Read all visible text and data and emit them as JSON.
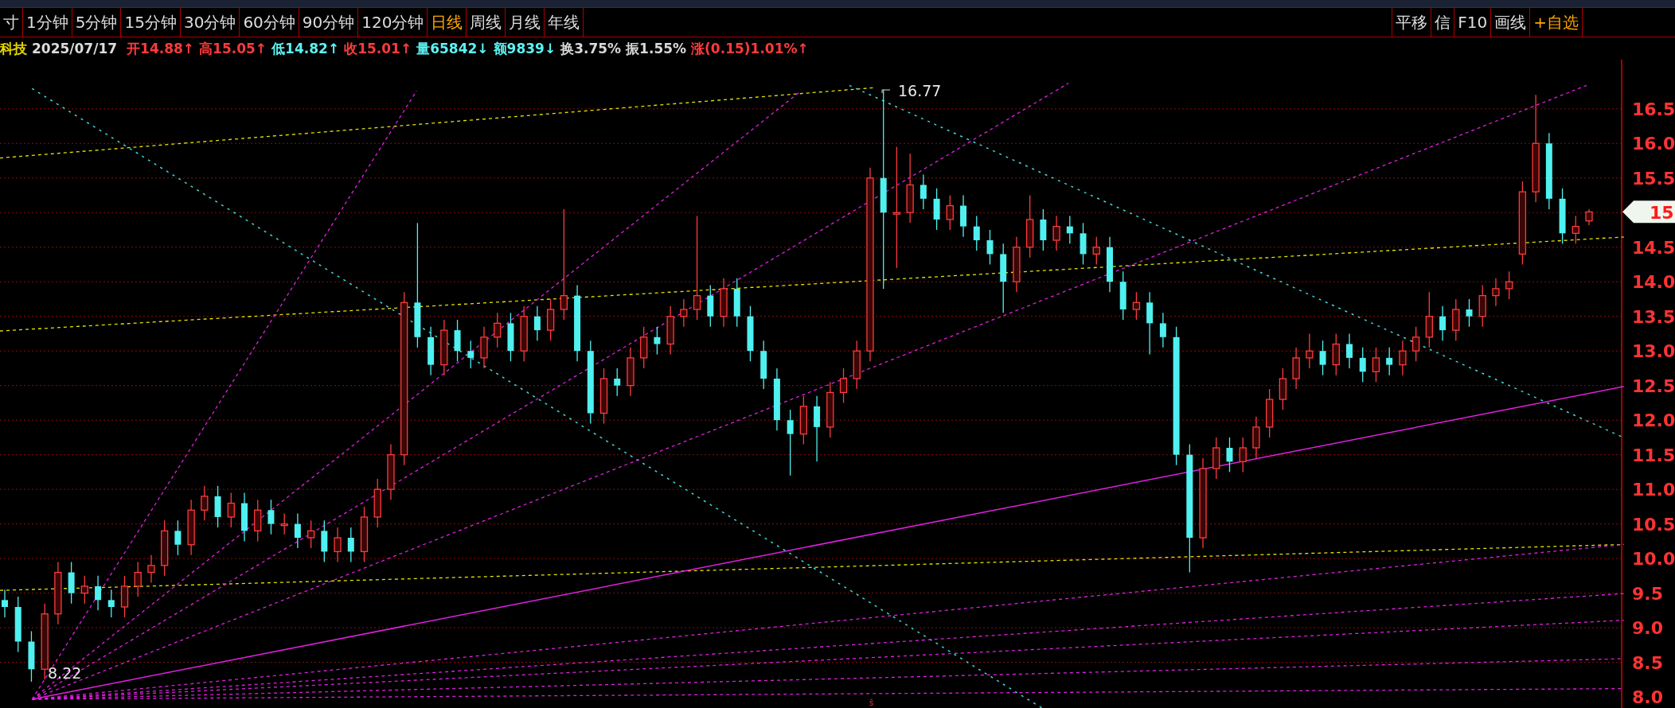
{
  "tabs": [
    {
      "label": "寸",
      "selected": false
    },
    {
      "label": "1分钟",
      "selected": false
    },
    {
      "label": "5分钟",
      "selected": false
    },
    {
      "label": "15分钟",
      "selected": false
    },
    {
      "label": "30分钟",
      "selected": false
    },
    {
      "label": "60分钟",
      "selected": false
    },
    {
      "label": "90分钟",
      "selected": false
    },
    {
      "label": "120分钟",
      "selected": false
    },
    {
      "label": "日线",
      "selected": true
    },
    {
      "label": "周线",
      "selected": false
    },
    {
      "label": "月线",
      "selected": false
    },
    {
      "label": "年线",
      "selected": false
    }
  ],
  "toolbar": [
    {
      "label": "平移",
      "kind": "plain"
    },
    {
      "label": "信",
      "kind": "plain"
    },
    {
      "label": "F10",
      "kind": "plain"
    },
    {
      "label": "画线",
      "kind": "plain"
    },
    {
      "label": "+自选",
      "kind": "add"
    }
  ],
  "info": {
    "name": "科技",
    "date": "2025/07/17",
    "fields": [
      {
        "label": "开",
        "value": "14.88",
        "arrow": "↑",
        "color": "#ff3b3b"
      },
      {
        "label": "高",
        "value": "15.05",
        "arrow": "↑",
        "color": "#ff3b3b"
      },
      {
        "label": "低",
        "value": "14.82",
        "arrow": "↑",
        "color": "#5cf2f2"
      },
      {
        "label": "收",
        "value": "15.01",
        "arrow": "↑",
        "color": "#ff3b3b"
      },
      {
        "label": "量",
        "value": "65842",
        "arrow": "↓",
        "color": "#5cf2f2"
      },
      {
        "label": "额",
        "value": "9839",
        "arrow": "↓",
        "color": "#5cf2f2"
      },
      {
        "label": "换",
        "value": "3.75%",
        "color": "#d8d8d8"
      },
      {
        "label": "振",
        "value": "1.55%",
        "color": "#d8d8d8"
      },
      {
        "label": "涨",
        "value": "(0.15)1.01%",
        "arrow": "↑",
        "color": "#ff3b3b"
      }
    ]
  },
  "chart": {
    "price_tag": "15.",
    "high_marker": "16.77",
    "low_marker": "8.22",
    "bottom_marker": "ŝ",
    "chart_data": {
      "type": "candlestick",
      "categories": [
        null,
        null,
        null,
        null,
        null,
        null,
        null,
        null,
        null,
        null,
        null,
        null,
        null,
        null,
        null,
        null,
        null,
        null,
        null,
        null,
        null,
        null,
        null,
        null,
        null,
        null,
        null,
        null,
        null,
        null,
        null,
        null,
        null,
        null,
        null,
        null,
        null,
        null,
        null,
        null,
        null,
        null,
        null,
        null,
        null,
        null,
        null,
        null,
        null,
        null,
        null,
        null,
        null,
        null,
        null,
        null,
        null,
        null,
        null,
        null,
        null,
        null,
        null,
        null,
        null,
        null,
        null,
        null,
        null,
        null,
        null,
        null,
        null,
        null,
        null,
        null,
        null,
        null,
        null,
        null,
        null,
        null,
        null,
        null,
        null,
        null,
        null,
        null,
        null,
        null,
        null,
        null,
        null,
        null,
        null,
        null,
        null,
        null,
        null,
        null,
        null,
        null,
        null,
        null,
        null,
        null,
        null,
        null,
        null,
        null,
        null,
        null,
        null,
        null,
        null,
        null,
        null,
        null,
        null,
        null
      ],
      "ohlc": [
        [
          9.4,
          9.55,
          9.15,
          9.3
        ],
        [
          9.3,
          9.45,
          8.65,
          8.8
        ],
        [
          8.8,
          8.95,
          8.22,
          8.4
        ],
        [
          8.4,
          9.35,
          8.25,
          9.2
        ],
        [
          9.2,
          9.95,
          9.05,
          9.8
        ],
        [
          9.8,
          9.95,
          9.35,
          9.5
        ],
        [
          9.5,
          9.75,
          9.35,
          9.6
        ],
        [
          9.6,
          9.75,
          9.25,
          9.4
        ],
        [
          9.4,
          9.55,
          9.15,
          9.3
        ],
        [
          9.3,
          9.75,
          9.15,
          9.6
        ],
        [
          9.6,
          9.95,
          9.45,
          9.8
        ],
        [
          9.8,
          10.05,
          9.65,
          9.9
        ],
        [
          9.9,
          10.55,
          9.75,
          10.4
        ],
        [
          10.4,
          10.55,
          10.05,
          10.2
        ],
        [
          10.2,
          10.85,
          10.05,
          10.7
        ],
        [
          10.7,
          11.05,
          10.55,
          10.9
        ],
        [
          10.9,
          11.05,
          10.45,
          10.6
        ],
        [
          10.6,
          10.95,
          10.45,
          10.8
        ],
        [
          10.8,
          10.95,
          10.25,
          10.4
        ],
        [
          10.4,
          10.85,
          10.25,
          10.7
        ],
        [
          10.7,
          10.85,
          10.35,
          10.5
        ],
        [
          10.5,
          10.65,
          10.35,
          10.5
        ],
        [
          10.5,
          10.65,
          10.15,
          10.3
        ],
        [
          10.3,
          10.55,
          10.15,
          10.4
        ],
        [
          10.4,
          10.55,
          9.95,
          10.1
        ],
        [
          10.1,
          10.45,
          9.95,
          10.3
        ],
        [
          10.3,
          10.45,
          9.95,
          10.1
        ],
        [
          10.1,
          10.75,
          9.95,
          10.6
        ],
        [
          10.6,
          11.15,
          10.45,
          11.0
        ],
        [
          11.0,
          11.65,
          10.85,
          11.5
        ],
        [
          11.5,
          13.85,
          11.35,
          13.7
        ],
        [
          13.7,
          14.85,
          13.05,
          13.2
        ],
        [
          13.2,
          13.35,
          12.65,
          12.8
        ],
        [
          12.8,
          13.45,
          12.65,
          13.3
        ],
        [
          13.3,
          13.45,
          12.85,
          13.0
        ],
        [
          13.0,
          13.15,
          12.75,
          12.9
        ],
        [
          12.9,
          13.35,
          12.75,
          13.2
        ],
        [
          13.2,
          13.55,
          13.05,
          13.4
        ],
        [
          13.4,
          13.55,
          12.85,
          13.0
        ],
        [
          13.0,
          13.65,
          12.85,
          13.5
        ],
        [
          13.5,
          13.65,
          13.15,
          13.3
        ],
        [
          13.3,
          13.75,
          13.15,
          13.6
        ],
        [
          13.6,
          15.05,
          13.45,
          13.8
        ],
        [
          13.8,
          13.95,
          12.85,
          13.0
        ],
        [
          13.0,
          13.15,
          11.95,
          12.1
        ],
        [
          12.1,
          12.75,
          11.95,
          12.6
        ],
        [
          12.6,
          12.75,
          12.35,
          12.5
        ],
        [
          12.5,
          13.05,
          12.35,
          12.9
        ],
        [
          12.9,
          13.35,
          12.75,
          13.2
        ],
        [
          13.2,
          13.35,
          12.95,
          13.1
        ],
        [
          13.1,
          13.65,
          12.95,
          13.5
        ],
        [
          13.5,
          13.75,
          13.35,
          13.6
        ],
        [
          13.6,
          14.95,
          13.45,
          13.8
        ],
        [
          13.8,
          13.95,
          13.35,
          13.5
        ],
        [
          13.5,
          14.05,
          13.35,
          13.9
        ],
        [
          13.9,
          14.05,
          13.35,
          13.5
        ],
        [
          13.5,
          13.65,
          12.85,
          13.0
        ],
        [
          13.0,
          13.15,
          12.45,
          12.6
        ],
        [
          12.6,
          12.75,
          11.85,
          12.0
        ],
        [
          12.0,
          12.15,
          11.2,
          11.8
        ],
        [
          11.8,
          12.35,
          11.65,
          12.2
        ],
        [
          12.2,
          12.35,
          11.4,
          11.9
        ],
        [
          11.9,
          12.55,
          11.75,
          12.4
        ],
        [
          12.4,
          12.75,
          12.25,
          12.6
        ],
        [
          12.6,
          13.15,
          12.45,
          13.0
        ],
        [
          13.0,
          15.65,
          12.85,
          15.5
        ],
        [
          15.5,
          16.77,
          13.9,
          15.0
        ],
        [
          15.0,
          15.95,
          14.2,
          15.0
        ],
        [
          15.0,
          15.85,
          14.85,
          15.4
        ],
        [
          15.4,
          15.55,
          15.05,
          15.2
        ],
        [
          15.2,
          15.35,
          14.75,
          14.9
        ],
        [
          14.9,
          15.25,
          14.75,
          15.1
        ],
        [
          15.1,
          15.25,
          14.65,
          14.8
        ],
        [
          14.8,
          14.95,
          14.45,
          14.6
        ],
        [
          14.6,
          14.75,
          14.25,
          14.4
        ],
        [
          14.4,
          14.55,
          13.55,
          14.0
        ],
        [
          14.0,
          14.65,
          13.85,
          14.5
        ],
        [
          14.5,
          15.25,
          14.35,
          14.9
        ],
        [
          14.9,
          15.05,
          14.45,
          14.6
        ],
        [
          14.6,
          14.95,
          14.45,
          14.8
        ],
        [
          14.8,
          14.95,
          14.55,
          14.7
        ],
        [
          14.7,
          14.85,
          14.25,
          14.4
        ],
        [
          14.4,
          14.65,
          14.25,
          14.5
        ],
        [
          14.5,
          14.65,
          13.85,
          14.0
        ],
        [
          14.0,
          14.15,
          13.45,
          13.6
        ],
        [
          13.6,
          13.85,
          13.45,
          13.7
        ],
        [
          13.7,
          13.85,
          12.95,
          13.4
        ],
        [
          13.4,
          13.55,
          13.05,
          13.2
        ],
        [
          13.2,
          13.35,
          11.35,
          11.5
        ],
        [
          11.5,
          11.65,
          9.8,
          10.3
        ],
        [
          10.3,
          11.45,
          10.15,
          11.3
        ],
        [
          11.3,
          11.75,
          11.15,
          11.6
        ],
        [
          11.6,
          11.75,
          11.25,
          11.4
        ],
        [
          11.4,
          11.75,
          11.25,
          11.6
        ],
        [
          11.6,
          12.05,
          11.45,
          11.9
        ],
        [
          11.9,
          12.45,
          11.75,
          12.3
        ],
        [
          12.3,
          12.75,
          12.15,
          12.6
        ],
        [
          12.6,
          13.05,
          12.45,
          12.9
        ],
        [
          12.9,
          13.25,
          12.75,
          13.0
        ],
        [
          13.0,
          13.15,
          12.65,
          12.8
        ],
        [
          12.8,
          13.25,
          12.65,
          13.1
        ],
        [
          13.1,
          13.25,
          12.75,
          12.9
        ],
        [
          12.9,
          13.05,
          12.55,
          12.7
        ],
        [
          12.7,
          13.05,
          12.55,
          12.9
        ],
        [
          12.9,
          13.05,
          12.65,
          12.8
        ],
        [
          12.8,
          13.15,
          12.65,
          13.0
        ],
        [
          13.0,
          13.35,
          12.85,
          13.2
        ],
        [
          13.2,
          13.85,
          13.05,
          13.5
        ],
        [
          13.5,
          13.65,
          13.15,
          13.3
        ],
        [
          13.3,
          13.75,
          13.15,
          13.6
        ],
        [
          13.6,
          13.75,
          13.35,
          13.5
        ],
        [
          13.5,
          13.95,
          13.35,
          13.8
        ],
        [
          13.8,
          14.05,
          13.65,
          13.9
        ],
        [
          13.9,
          14.15,
          13.75,
          14.0
        ],
        [
          14.4,
          15.45,
          14.25,
          15.3
        ],
        [
          15.3,
          16.7,
          15.15,
          16.0
        ],
        [
          16.0,
          16.15,
          15.05,
          15.2
        ],
        [
          15.2,
          15.35,
          14.55,
          14.7
        ],
        [
          14.7,
          14.95,
          14.55,
          14.8
        ],
        [
          14.88,
          15.05,
          14.82,
          15.01
        ]
      ],
      "ylim": [
        7.84,
        17.21
      ],
      "yticks": [
        {
          "value": 16.5,
          "label": "16.5"
        },
        {
          "value": 16.0,
          "label": "16.0"
        },
        {
          "value": 15.5,
          "label": "15.5"
        },
        {
          "value": 14.5,
          "label": "14.5"
        },
        {
          "value": 14.0,
          "label": "14.0"
        },
        {
          "value": 13.5,
          "label": "13.5"
        },
        {
          "value": 13.0,
          "label": "13.0"
        },
        {
          "value": 12.5,
          "label": "12.5"
        },
        {
          "value": 12.0,
          "label": "12.0"
        },
        {
          "value": 11.5,
          "label": "11.5"
        },
        {
          "value": 11.0,
          "label": "11.0"
        },
        {
          "value": 10.5,
          "label": "10.5"
        },
        {
          "value": 10.0,
          "label": "10.0"
        },
        {
          "value": 9.5,
          "label": "9.5"
        },
        {
          "value": 9.0,
          "label": "9.0"
        },
        {
          "value": 8.5,
          "label": "8.5"
        },
        {
          "value": 8.0,
          "label": "8.0"
        }
      ]
    }
  }
}
